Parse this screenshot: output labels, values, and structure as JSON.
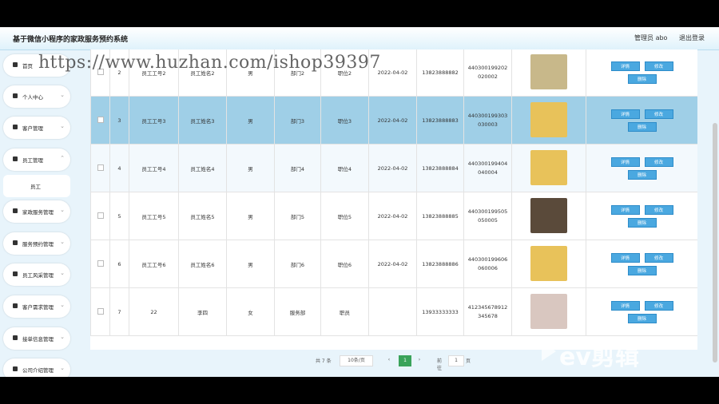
{
  "header": {
    "title": "基于微信小程序的家政服务预约系统",
    "user": "管理员 abo",
    "logout": "退出登录"
  },
  "sidebar": {
    "items": [
      {
        "label": "首页",
        "icon": "home-icon"
      },
      {
        "label": "个人中心",
        "icon": "user-icon"
      },
      {
        "label": "客户管理",
        "icon": "folder-icon"
      },
      {
        "label": "员工管理",
        "icon": "shield-icon"
      },
      {
        "label": "家政服务管理",
        "icon": "folder-icon"
      },
      {
        "label": "服务预约管理",
        "icon": "chart-icon"
      },
      {
        "label": "员工风采管理",
        "icon": "grid-icon"
      },
      {
        "label": "客户需求管理",
        "icon": "grid-icon"
      },
      {
        "label": "接单信息管理",
        "icon": "chart-icon"
      },
      {
        "label": "公司介绍管理",
        "icon": "grid-icon"
      }
    ],
    "sub_item": "员工"
  },
  "table": {
    "rows": [
      {
        "no": "2",
        "emp_no": "员工工号2",
        "name": "员工姓名2",
        "gender": "男",
        "dept": "部门2",
        "post": "职位2",
        "date": "2022-04-02",
        "phone": "13823888882",
        "idcard": "440300199202020002",
        "photo_color": "#c8b88a"
      },
      {
        "no": "3",
        "emp_no": "员工工号3",
        "name": "员工姓名3",
        "gender": "男",
        "dept": "部门3",
        "post": "职位3",
        "date": "2022-04-02",
        "phone": "13823888883",
        "idcard": "440300199303030003",
        "photo_color": "#e8c25a"
      },
      {
        "no": "4",
        "emp_no": "员工工号4",
        "name": "员工姓名4",
        "gender": "男",
        "dept": "部门4",
        "post": "职位4",
        "date": "2022-04-02",
        "phone": "13823888884",
        "idcard": "440300199404040004",
        "photo_color": "#e8c25a"
      },
      {
        "no": "5",
        "emp_no": "员工工号5",
        "name": "员工姓名5",
        "gender": "男",
        "dept": "部门5",
        "post": "职位5",
        "date": "2022-04-02",
        "phone": "13823888885",
        "idcard": "440300199505050005",
        "photo_color": "#5a4a3a"
      },
      {
        "no": "6",
        "emp_no": "员工工号6",
        "name": "员工姓名6",
        "gender": "男",
        "dept": "部门6",
        "post": "职位6",
        "date": "2022-04-02",
        "phone": "13823888886",
        "idcard": "440300199606060006",
        "photo_color": "#e8c25a"
      },
      {
        "no": "7",
        "emp_no": "22",
        "name": "李四",
        "gender": "女",
        "dept": "服务部",
        "post": "职员",
        "date": "",
        "phone": "13933333333",
        "idcard": "412345678912345678",
        "photo_color": "#d9c7c0"
      }
    ],
    "btn_detail": "详情",
    "btn_edit": "修改",
    "btn_delete": "删除"
  },
  "pager": {
    "total": "共 7 条",
    "page_size": "10条/页",
    "current": "1",
    "goto_label": "前往",
    "goto_value": "1",
    "page_unit": "页"
  },
  "overlay": {
    "watermark": "https://www.huzhan.com/ishop39397",
    "ev_text": "ev剪辑"
  },
  "colors": {
    "accent": "#4aa8e0",
    "selected_row": "#9fcfe7",
    "page_bg": "#e8f4fb"
  }
}
